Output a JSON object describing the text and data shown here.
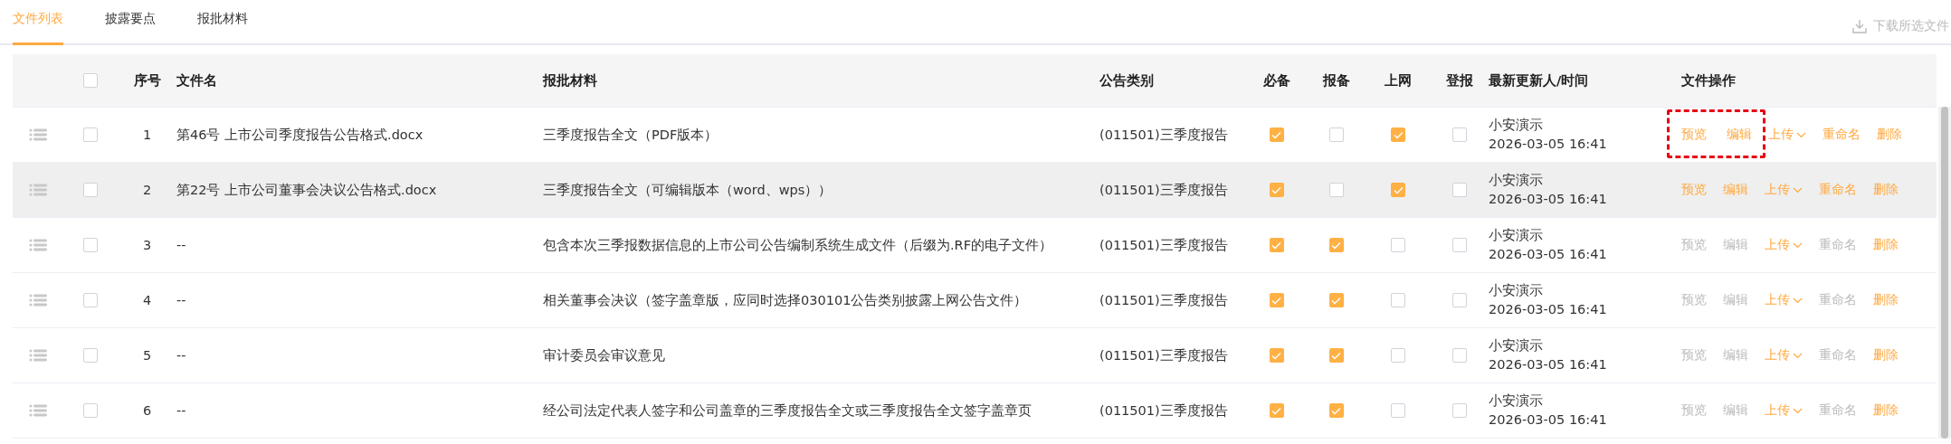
{
  "tabs": [
    {
      "label": "文件列表",
      "selected": true
    },
    {
      "label": "披露要点",
      "selected": false
    },
    {
      "label": "报批材料",
      "selected": false
    }
  ],
  "download_button": {
    "label": "下载所选文件",
    "disabled": true
  },
  "table": {
    "header_checkbox": {
      "checked": false
    },
    "columns": [
      "序号",
      "文件名",
      "报批材料",
      "公告类别",
      "必备",
      "报备",
      "上网",
      "登报",
      "最新更新人/时间",
      "文件操作"
    ],
    "rows": [
      {
        "selected": false,
        "hovered": false,
        "index": "1",
        "file_name": "第46号 上市公司季度报告公告格式.docx",
        "material": "三季度报告全文（PDF版本）",
        "category": "(011501)三季度报告",
        "flags": [
          {
            "checked": true
          },
          {
            "checked": false
          },
          {
            "checked": true
          },
          {
            "checked": false
          }
        ],
        "updater": "小安演示",
        "updated_at": "2026-03-05 16:41",
        "highlight": true,
        "actions": [
          {
            "kind": "link",
            "label": "预览",
            "disabled": false
          },
          {
            "kind": "link",
            "label": "编辑",
            "disabled": false
          },
          {
            "kind": "dropdown",
            "label": "上传",
            "disabled": false
          },
          {
            "kind": "link",
            "label": "重命名",
            "disabled": false
          },
          {
            "kind": "link",
            "label": "删除",
            "disabled": false
          }
        ]
      },
      {
        "selected": false,
        "hovered": true,
        "index": "2",
        "file_name": "第22号 上市公司董事会决议公告格式.docx",
        "material": "三季度报告全文（可编辑版本（word、wps））",
        "category": "(011501)三季度报告",
        "flags": [
          {
            "checked": true
          },
          {
            "checked": false
          },
          {
            "checked": true
          },
          {
            "checked": false
          }
        ],
        "updater": "小安演示",
        "updated_at": "2026-03-05 16:41",
        "highlight": false,
        "actions": [
          {
            "kind": "link",
            "label": "预览",
            "disabled": false
          },
          {
            "kind": "link",
            "label": "编辑",
            "disabled": false
          },
          {
            "kind": "dropdown",
            "label": "上传",
            "disabled": false
          },
          {
            "kind": "link",
            "label": "重命名",
            "disabled": false
          },
          {
            "kind": "link",
            "label": "删除",
            "disabled": false
          }
        ]
      },
      {
        "selected": false,
        "hovered": false,
        "index": "3",
        "file_name": "--",
        "material": "包含本次三季报数据信息的上市公司公告编制系统生成文件（后缀为.RF的电子文件）",
        "category": "(011501)三季度报告",
        "flags": [
          {
            "checked": true
          },
          {
            "checked": true
          },
          {
            "checked": false
          },
          {
            "checked": false
          }
        ],
        "updater": "小安演示",
        "updated_at": "2026-03-05 16:41",
        "highlight": false,
        "actions": [
          {
            "kind": "link",
            "label": "预览",
            "disabled": true
          },
          {
            "kind": "link",
            "label": "编辑",
            "disabled": true
          },
          {
            "kind": "dropdown",
            "label": "上传",
            "disabled": false
          },
          {
            "kind": "link",
            "label": "重命名",
            "disabled": true
          },
          {
            "kind": "link",
            "label": "删除",
            "disabled": false
          }
        ]
      },
      {
        "selected": false,
        "hovered": false,
        "index": "4",
        "file_name": "--",
        "material": "相关董事会决议（签字盖章版，应同时选择030101公告类别披露上网公告文件）",
        "category": "(011501)三季度报告",
        "flags": [
          {
            "checked": true
          },
          {
            "checked": true
          },
          {
            "checked": false
          },
          {
            "checked": false
          }
        ],
        "updater": "小安演示",
        "updated_at": "2026-03-05 16:41",
        "highlight": false,
        "actions": [
          {
            "kind": "link",
            "label": "预览",
            "disabled": true
          },
          {
            "kind": "link",
            "label": "编辑",
            "disabled": true
          },
          {
            "kind": "dropdown",
            "label": "上传",
            "disabled": false
          },
          {
            "kind": "link",
            "label": "重命名",
            "disabled": true
          },
          {
            "kind": "link",
            "label": "删除",
            "disabled": false
          }
        ]
      },
      {
        "selected": false,
        "hovered": false,
        "index": "5",
        "file_name": "--",
        "material": "审计委员会审议意见",
        "category": "(011501)三季度报告",
        "flags": [
          {
            "checked": true
          },
          {
            "checked": true
          },
          {
            "checked": false
          },
          {
            "checked": false
          }
        ],
        "updater": "小安演示",
        "updated_at": "2026-03-05 16:41",
        "highlight": false,
        "actions": [
          {
            "kind": "link",
            "label": "预览",
            "disabled": true
          },
          {
            "kind": "link",
            "label": "编辑",
            "disabled": true
          },
          {
            "kind": "dropdown",
            "label": "上传",
            "disabled": false
          },
          {
            "kind": "link",
            "label": "重命名",
            "disabled": true
          },
          {
            "kind": "link",
            "label": "删除",
            "disabled": false
          }
        ]
      },
      {
        "selected": false,
        "hovered": false,
        "index": "6",
        "file_name": "--",
        "material": "经公司法定代表人签字和公司盖章的三季度报告全文或三季度报告全文签字盖章页",
        "category": "(011501)三季度报告",
        "flags": [
          {
            "checked": true
          },
          {
            "checked": true
          },
          {
            "checked": false
          },
          {
            "checked": false
          }
        ],
        "updater": "小安演示",
        "updated_at": "2026-03-05 16:41",
        "highlight": false,
        "actions": [
          {
            "kind": "link",
            "label": "预览",
            "disabled": true
          },
          {
            "kind": "link",
            "label": "编辑",
            "disabled": true
          },
          {
            "kind": "dropdown",
            "label": "上传",
            "disabled": false
          },
          {
            "kind": "link",
            "label": "重命名",
            "disabled": true
          },
          {
            "kind": "link",
            "label": "删除",
            "disabled": false
          }
        ]
      }
    ]
  }
}
